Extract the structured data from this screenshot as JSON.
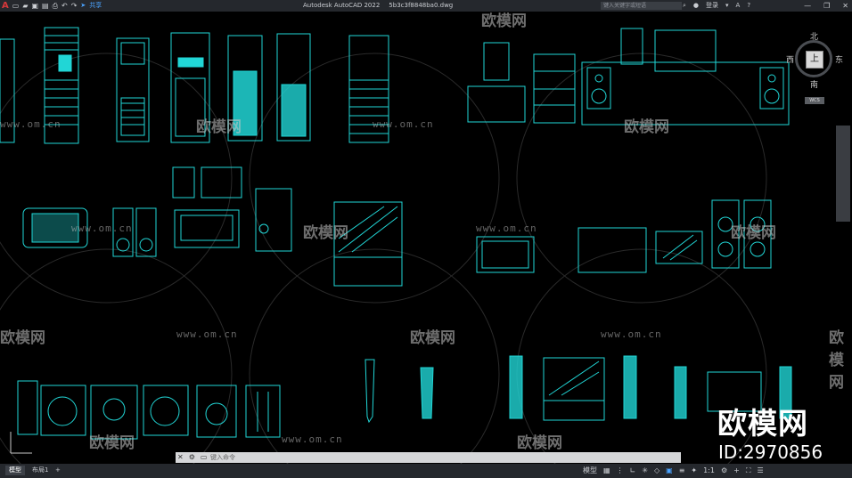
{
  "titlebar": {
    "app_icon": "A",
    "quick_access": [
      "new-icon",
      "open-icon",
      "save-icon",
      "saveas-icon",
      "plot-icon",
      "undo-icon",
      "redo-icon",
      "share-arrow-icon"
    ],
    "share_label": "共享",
    "app_name": "Autodesk AutoCAD 2022",
    "file_name": "5b3c3f8848ba0.dwg",
    "search_placeholder": "键入关键字或短语",
    "login_label": "登录"
  },
  "viewcube": {
    "north": "北",
    "south": "南",
    "east": "东",
    "west": "西",
    "face": "上",
    "wcs": "WCS"
  },
  "watermark": {
    "site": "www.om.cn",
    "logo_text": "欧模网"
  },
  "branding": {
    "logo": "欧模网",
    "id": "ID:2970856"
  },
  "command": {
    "placeholder": "键入命令"
  },
  "statusbar": {
    "tabs": [
      "模型",
      "布局1"
    ],
    "add_tab": "+",
    "model_label": "模型",
    "scale": "1:1"
  },
  "colors": {
    "drawing": "#21d6d6",
    "background": "#000000"
  }
}
